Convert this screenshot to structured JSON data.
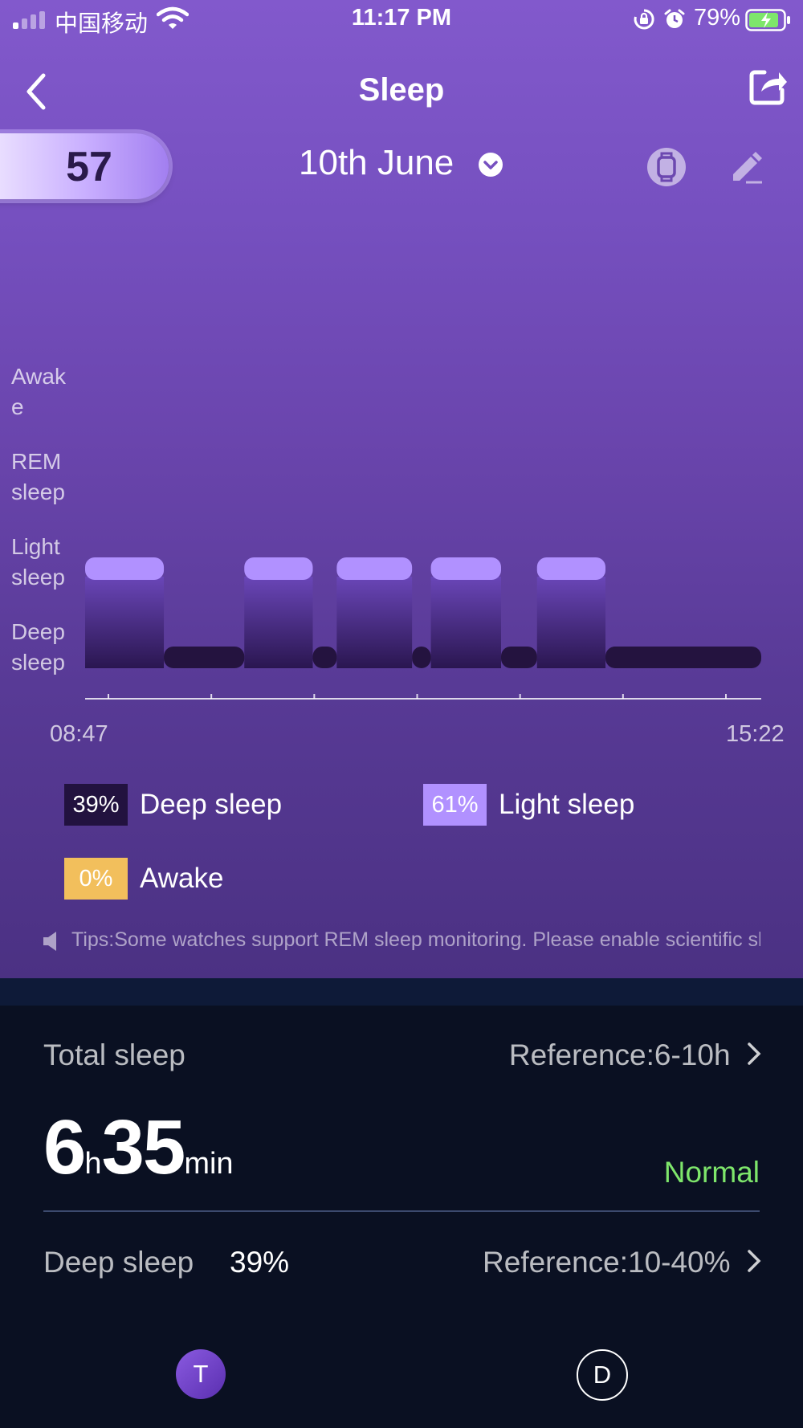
{
  "status_bar": {
    "carrier": "中国移动",
    "time": "11:17 PM",
    "battery": "79%"
  },
  "header": {
    "title": "Sleep"
  },
  "score": "57",
  "date": "10th June",
  "chart_data": {
    "type": "step",
    "y_categories": [
      "Awake",
      "REM sleep",
      "Light sleep",
      "Deep sleep"
    ],
    "y_labels": [
      "Awak\ne",
      "REM\nsleep",
      "Light\nsleep",
      "Deep\nsleep"
    ],
    "x_start": "08:47",
    "x_end": "15:22",
    "segments": [
      {
        "stage": "Light sleep",
        "start": "08:47",
        "end": "09:33"
      },
      {
        "stage": "Deep sleep",
        "start": "09:33",
        "end": "10:20"
      },
      {
        "stage": "Light sleep",
        "start": "10:20",
        "end": "11:00"
      },
      {
        "stage": "Deep sleep",
        "start": "11:00",
        "end": "11:14"
      },
      {
        "stage": "Light sleep",
        "start": "11:14",
        "end": "11:58"
      },
      {
        "stage": "Deep sleep",
        "start": "11:58",
        "end": "12:09"
      },
      {
        "stage": "Light sleep",
        "start": "12:09",
        "end": "12:50"
      },
      {
        "stage": "Deep sleep",
        "start": "12:50",
        "end": "13:11"
      },
      {
        "stage": "Light sleep",
        "start": "13:11",
        "end": "13:51"
      },
      {
        "stage": "Deep sleep",
        "start": "13:51",
        "end": "15:22"
      }
    ],
    "ticks": 7
  },
  "legend": [
    {
      "percent": "39%",
      "label": "Deep sleep",
      "color": "#22123f"
    },
    {
      "percent": "61%",
      "label": "Light sleep",
      "color": "#b191ff"
    },
    {
      "percent": "0%",
      "label": "Awake",
      "color": "#f2bf5c"
    }
  ],
  "tips": "Tips:Some watches support REM sleep monitoring. Please enable scientific sleep",
  "total_sleep": {
    "label": "Total sleep",
    "reference": "Reference:6-10h",
    "hours": "6",
    "hours_unit": "h",
    "minutes": "35",
    "minutes_unit": "min",
    "status": "Normal"
  },
  "deep_sleep": {
    "label": "Deep sleep",
    "value": "39%",
    "reference": "Reference:10-40%"
  },
  "bottom_nav": [
    {
      "letter": "T"
    },
    {
      "letter": "D"
    }
  ]
}
